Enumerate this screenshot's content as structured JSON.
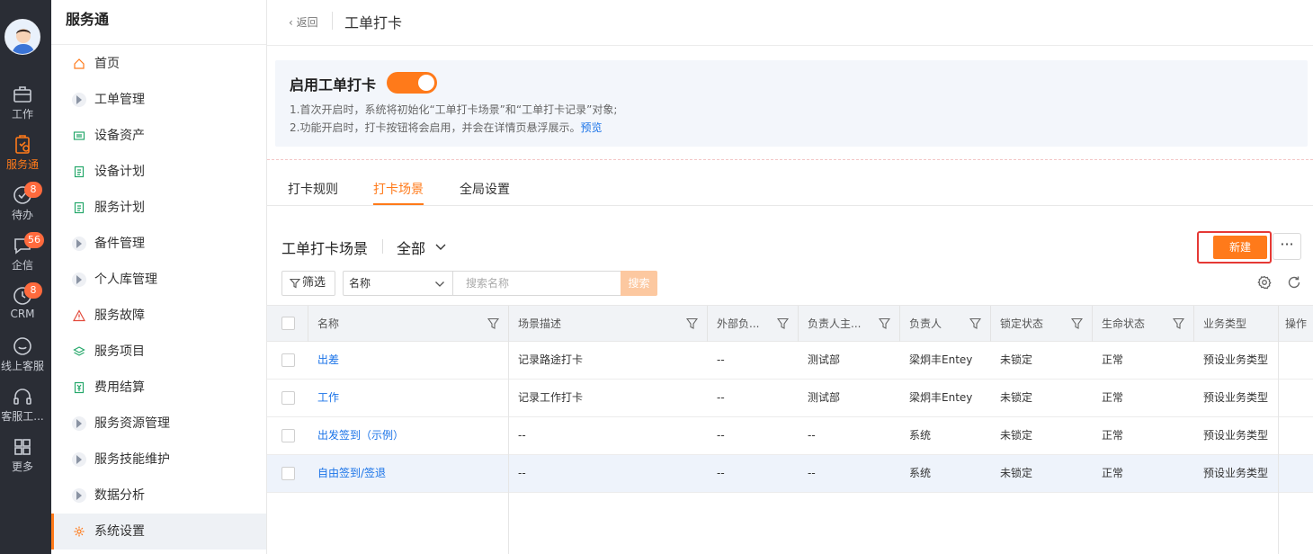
{
  "rail": {
    "items": [
      {
        "label": "工作",
        "icon": "briefcase-icon"
      },
      {
        "label": "服务通",
        "icon": "service-icon"
      },
      {
        "label": "待办",
        "icon": "check-circle-icon",
        "badge": "8"
      },
      {
        "label": "企信",
        "icon": "chat-icon",
        "badge": "56"
      },
      {
        "label": "CRM",
        "icon": "clock-icon",
        "badge": "8"
      },
      {
        "label": "线上客服",
        "icon": "smile-chat-icon"
      },
      {
        "label": "客服工...",
        "icon": "headset-icon"
      },
      {
        "label": "更多",
        "icon": "grid-icon"
      }
    ]
  },
  "sidebar": {
    "title": "服务通",
    "items": [
      {
        "label": "首页"
      },
      {
        "label": "工单管理"
      },
      {
        "label": "设备资产"
      },
      {
        "label": "设备计划"
      },
      {
        "label": "服务计划"
      },
      {
        "label": "备件管理"
      },
      {
        "label": "个人库管理"
      },
      {
        "label": "服务故障"
      },
      {
        "label": "服务项目"
      },
      {
        "label": "费用结算"
      },
      {
        "label": "服务资源管理"
      },
      {
        "label": "服务技能维护"
      },
      {
        "label": "数据分析"
      },
      {
        "label": "系统设置"
      }
    ]
  },
  "header": {
    "back": "返回",
    "title": "工单打卡"
  },
  "banner": {
    "title": "启用工单打卡",
    "toggle_on": true,
    "line1": "1.首次开启时，系统将初始化“工单打卡场景”和“工单打卡记录”对象;",
    "line2": "2.功能开启时，打卡按钮将会启用，并会在详情页悬浮展示。",
    "link": "预览"
  },
  "tabs": [
    {
      "label": "打卡规则"
    },
    {
      "label": "打卡场景"
    },
    {
      "label": "全局设置"
    }
  ],
  "list": {
    "title": "工单打卡场景",
    "scope": "全部",
    "new_label": "新建",
    "more_label": "···",
    "filter_label": "筛选",
    "field_select": "名称",
    "search_placeholder": "搜索名称",
    "search_label": "搜索"
  },
  "table": {
    "headers": [
      "名称",
      "场景描述",
      "外部负...",
      "负责人主...",
      "负责人",
      "锁定状态",
      "生命状态",
      "业务类型",
      "操作"
    ],
    "rows": [
      [
        "出差",
        "记录路途打卡",
        "--",
        "测试部",
        "梁炯丰Entey",
        "未锁定",
        "正常",
        "预设业务类型"
      ],
      [
        "工作",
        "记录工作打卡",
        "--",
        "测试部",
        "梁炯丰Entey",
        "未锁定",
        "正常",
        "预设业务类型"
      ],
      [
        "出发签到（示例）",
        "--",
        "--",
        "--",
        "系统",
        "未锁定",
        "正常",
        "预设业务类型"
      ],
      [
        "自由签到/签退",
        "--",
        "--",
        "--",
        "系统",
        "未锁定",
        "正常",
        "预设业务类型"
      ]
    ]
  },
  "colors": {
    "accent": "#ff7a1a",
    "link": "#1a73e8",
    "rail_bg": "#2a2d35",
    "highlight_border": "#e53935"
  }
}
